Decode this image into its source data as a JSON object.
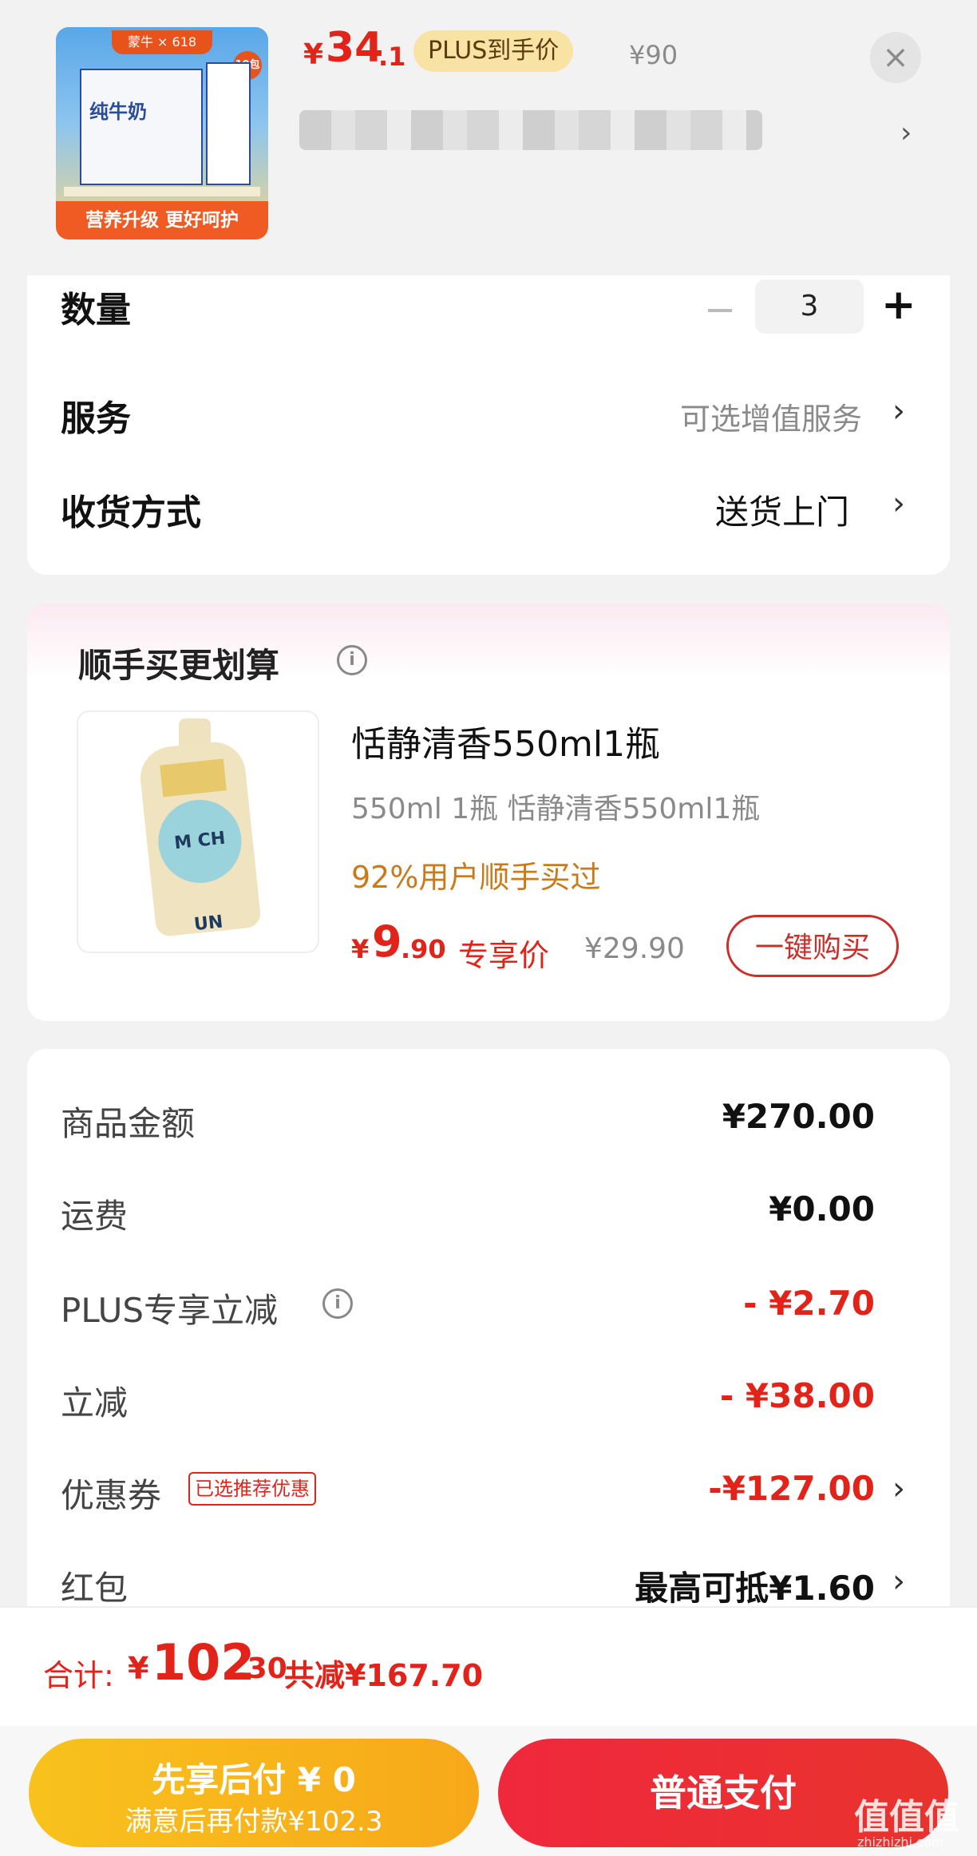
{
  "header": {
    "thumbnail": {
      "brand_text": "蒙牛 × 618",
      "badge": "10包",
      "box_text": "纯牛奶",
      "banner": "营养升级 更好呵护"
    },
    "price": {
      "currency": "¥",
      "integer": "34",
      "decimal": ".1"
    },
    "plus_tag": "PLUS到手价",
    "original_price": "¥90",
    "close_icon": "×",
    "spec_arrow": "›"
  },
  "order": {
    "quantity": {
      "label": "数量",
      "minus": "−",
      "value": "3",
      "plus": "+"
    },
    "service": {
      "label": "服务",
      "value": "可选增值服务",
      "arrow": "›"
    },
    "delivery": {
      "label": "收货方式",
      "value": "送货上门",
      "arrow": "›"
    }
  },
  "upsell": {
    "title": "顺手买更划算",
    "info_icon": "i",
    "product": {
      "image_text": "M CH UN",
      "name": "恬静清香550ml1瓶",
      "spec": "550ml 1瓶   恬静清香550ml1瓶",
      "social_proof": "92%用户顺手买过",
      "price_currency": "¥",
      "price_integer": "9",
      "price_decimal": ".90",
      "price_label": "专享价",
      "original_price": "¥29.90",
      "buy_button": "一键购买"
    }
  },
  "fees": {
    "items_total": {
      "label": "商品金额",
      "value": "¥270.00"
    },
    "shipping": {
      "label": "运费",
      "value": "¥0.00"
    },
    "plus_discount": {
      "label": "PLUS专享立减",
      "info_icon": "i",
      "value": "- ¥2.70"
    },
    "instant_discount": {
      "label": "立减",
      "value": "- ¥38.00"
    },
    "coupon": {
      "label": "优惠券",
      "tag": "已选推荐优惠",
      "value": "-¥127.00",
      "arrow": "›"
    },
    "red_packet": {
      "label": "红包",
      "value": "最高可抵¥1.60",
      "arrow": "›"
    }
  },
  "total": {
    "label": "合计:",
    "currency": "¥",
    "integer": "102",
    "decimal": ".30",
    "saved": "共减¥167.70"
  },
  "actions": {
    "pay_later_line1": "先享后付 ¥ 0",
    "pay_later_line2": "满意后再付款¥102.3",
    "pay_now": "普通支付"
  },
  "watermark": {
    "main": "值值值",
    "sub": "zhizhizhi.com"
  },
  "colors": {
    "accent_red": "#e2231a",
    "gold": "#f7b31b",
    "plus_tag_bg": "#f8e3a4",
    "social_proof": "#c97b1b"
  }
}
